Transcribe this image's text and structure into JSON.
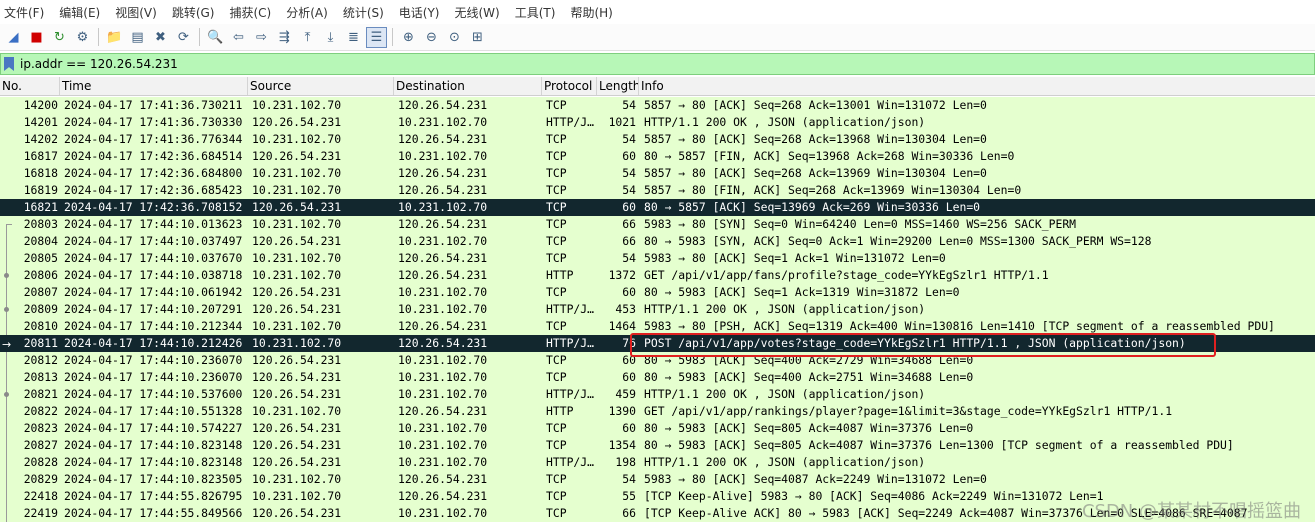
{
  "menu": [
    "文件(F)",
    "编辑(E)",
    "视图(V)",
    "跳转(G)",
    "捕获(C)",
    "分析(A)",
    "统计(S)",
    "电话(Y)",
    "无线(W)",
    "工具(T)",
    "帮助(H)"
  ],
  "toolbar": [
    {
      "name": "start-capture-icon",
      "glyph": "◢"
    },
    {
      "name": "stop-capture-icon",
      "glyph": "■"
    },
    {
      "name": "restart-capture-icon",
      "glyph": "↻"
    },
    {
      "name": "capture-options-icon",
      "glyph": "⚙"
    },
    {
      "sep": true
    },
    {
      "name": "open-file-icon",
      "glyph": "📁"
    },
    {
      "name": "save-file-icon",
      "glyph": "▤"
    },
    {
      "name": "close-file-icon",
      "glyph": "✖"
    },
    {
      "name": "reload-file-icon",
      "glyph": "⟳"
    },
    {
      "sep": true
    },
    {
      "name": "find-packet-icon",
      "glyph": "🔍"
    },
    {
      "name": "go-back-icon",
      "glyph": "⇦"
    },
    {
      "name": "go-forward-icon",
      "glyph": "⇨"
    },
    {
      "name": "go-to-packet-icon",
      "glyph": "⇶"
    },
    {
      "name": "go-first-packet-icon",
      "glyph": "⤒"
    },
    {
      "name": "go-last-packet-icon",
      "glyph": "⤓"
    },
    {
      "name": "auto-scroll-icon",
      "glyph": "≣"
    },
    {
      "name": "colorize-icon",
      "glyph": "☰",
      "active": true
    },
    {
      "sep": true
    },
    {
      "name": "zoom-in-icon",
      "glyph": "⊕"
    },
    {
      "name": "zoom-out-icon",
      "glyph": "⊖"
    },
    {
      "name": "zoom-normal-icon",
      "glyph": "⊙"
    },
    {
      "name": "resize-columns-icon",
      "glyph": "⊞"
    }
  ],
  "filter": {
    "value": "ip.addr == 120.26.54.231"
  },
  "columns": {
    "no": "No.",
    "time": "Time",
    "source": "Source",
    "destination": "Destination",
    "protocol": "Protocol",
    "length": "Length",
    "info": "Info"
  },
  "colors": {
    "row_bg": "#e5ffcf",
    "selected_bg": "#12272e",
    "filter_bg": "#b7f7b7",
    "highlight": "#e02020"
  },
  "packets": [
    {
      "no": "14200",
      "time": "2024-04-17 17:41:36.730211",
      "src": "10.231.102.70",
      "dst": "120.26.54.231",
      "proto": "TCP",
      "len": "54",
      "info": "5857 → 80 [ACK] Seq=268 Ack=13001 Win=131072 Len=0",
      "rel": "none",
      "sel": false
    },
    {
      "no": "14201",
      "time": "2024-04-17 17:41:36.730330",
      "src": "120.26.54.231",
      "dst": "10.231.102.70",
      "proto": "HTTP/J…",
      "len": "1021",
      "info": "HTTP/1.1 200 OK , JSON (application/json)",
      "rel": "none",
      "sel": false
    },
    {
      "no": "14202",
      "time": "2024-04-17 17:41:36.776344",
      "src": "10.231.102.70",
      "dst": "120.26.54.231",
      "proto": "TCP",
      "len": "54",
      "info": "5857 → 80 [ACK] Seq=268 Ack=13968 Win=130304 Len=0",
      "rel": "none",
      "sel": false
    },
    {
      "no": "16817",
      "time": "2024-04-17 17:42:36.684514",
      "src": "120.26.54.231",
      "dst": "10.231.102.70",
      "proto": "TCP",
      "len": "60",
      "info": "80 → 5857 [FIN, ACK] Seq=13968 Ack=268 Win=30336 Len=0",
      "rel": "none",
      "sel": false
    },
    {
      "no": "16818",
      "time": "2024-04-17 17:42:36.684800",
      "src": "10.231.102.70",
      "dst": "120.26.54.231",
      "proto": "TCP",
      "len": "54",
      "info": "5857 → 80 [ACK] Seq=268 Ack=13969 Win=130304 Len=0",
      "rel": "none",
      "sel": false
    },
    {
      "no": "16819",
      "time": "2024-04-17 17:42:36.685423",
      "src": "10.231.102.70",
      "dst": "120.26.54.231",
      "proto": "TCP",
      "len": "54",
      "info": "5857 → 80 [FIN, ACK] Seq=268 Ack=13969 Win=130304 Len=0",
      "rel": "none",
      "sel": false
    },
    {
      "no": "16821",
      "time": "2024-04-17 17:42:36.708152",
      "src": "120.26.54.231",
      "dst": "10.231.102.70",
      "proto": "TCP",
      "len": "60",
      "info": "80 → 5857 [ACK] Seq=13969 Ack=269 Win=30336 Len=0",
      "rel": "none",
      "sel": true
    },
    {
      "no": "20803",
      "time": "2024-04-17 17:44:10.013623",
      "src": "10.231.102.70",
      "dst": "120.26.54.231",
      "proto": "TCP",
      "len": "66",
      "info": "5983 → 80 [SYN] Seq=0 Win=64240 Len=0 MSS=1460 WS=256 SACK_PERM",
      "rel": "first",
      "sel": false
    },
    {
      "no": "20804",
      "time": "2024-04-17 17:44:10.037497",
      "src": "120.26.54.231",
      "dst": "10.231.102.70",
      "proto": "TCP",
      "len": "66",
      "info": "80 → 5983 [SYN, ACK] Seq=0 Ack=1 Win=29200 Len=0 MSS=1300 SACK_PERM WS=128",
      "rel": "line",
      "sel": false
    },
    {
      "no": "20805",
      "time": "2024-04-17 17:44:10.037670",
      "src": "10.231.102.70",
      "dst": "120.26.54.231",
      "proto": "TCP",
      "len": "54",
      "info": "5983 → 80 [ACK] Seq=1 Ack=1 Win=131072 Len=0",
      "rel": "line",
      "sel": false
    },
    {
      "no": "20806",
      "time": "2024-04-17 17:44:10.038718",
      "src": "10.231.102.70",
      "dst": "120.26.54.231",
      "proto": "HTTP",
      "len": "1372",
      "info": "GET /api/v1/app/fans/profile?stage_code=YYkEgSzlr1 HTTP/1.1",
      "rel": "dot",
      "sel": false
    },
    {
      "no": "20807",
      "time": "2024-04-17 17:44:10.061942",
      "src": "120.26.54.231",
      "dst": "10.231.102.70",
      "proto": "TCP",
      "len": "60",
      "info": "80 → 5983 [ACK] Seq=1 Ack=1319 Win=31872 Len=0",
      "rel": "line",
      "sel": false
    },
    {
      "no": "20809",
      "time": "2024-04-17 17:44:10.207291",
      "src": "120.26.54.231",
      "dst": "10.231.102.70",
      "proto": "HTTP/J…",
      "len": "453",
      "info": "HTTP/1.1 200 OK , JSON (application/json)",
      "rel": "dot",
      "sel": false
    },
    {
      "no": "20810",
      "time": "2024-04-17 17:44:10.212344",
      "src": "10.231.102.70",
      "dst": "120.26.54.231",
      "proto": "TCP",
      "len": "1464",
      "info": "5983 → 80 [PSH, ACK] Seq=1319 Ack=400 Win=130816 Len=1410 [TCP segment of a reassembled PDU]",
      "rel": "line",
      "sel": false
    },
    {
      "no": "20811",
      "time": "2024-04-17 17:44:10.212426",
      "src": "10.231.102.70",
      "dst": "120.26.54.231",
      "proto": "HTTP/J…",
      "len": "76",
      "info": "POST /api/v1/app/votes?stage_code=YYkEgSzlr1 HTTP/1.1 , JSON (application/json)",
      "rel": "arrow",
      "sel": true
    },
    {
      "no": "20812",
      "time": "2024-04-17 17:44:10.236070",
      "src": "120.26.54.231",
      "dst": "10.231.102.70",
      "proto": "TCP",
      "len": "60",
      "info": "80 → 5983 [ACK] Seq=400 Ack=2729 Win=34688 Len=0",
      "rel": "line",
      "sel": false
    },
    {
      "no": "20813",
      "time": "2024-04-17 17:44:10.236070",
      "src": "120.26.54.231",
      "dst": "10.231.102.70",
      "proto": "TCP",
      "len": "60",
      "info": "80 → 5983 [ACK] Seq=400 Ack=2751 Win=34688 Len=0",
      "rel": "line",
      "sel": false
    },
    {
      "no": "20821",
      "time": "2024-04-17 17:44:10.537600",
      "src": "120.26.54.231",
      "dst": "10.231.102.70",
      "proto": "HTTP/J…",
      "len": "459",
      "info": "HTTP/1.1 200 OK , JSON (application/json)",
      "rel": "dot",
      "sel": false
    },
    {
      "no": "20822",
      "time": "2024-04-17 17:44:10.551328",
      "src": "10.231.102.70",
      "dst": "120.26.54.231",
      "proto": "HTTP",
      "len": "1390",
      "info": "GET /api/v1/app/rankings/player?page=1&limit=3&stage_code=YYkEgSzlr1 HTTP/1.1",
      "rel": "line",
      "sel": false
    },
    {
      "no": "20823",
      "time": "2024-04-17 17:44:10.574227",
      "src": "120.26.54.231",
      "dst": "10.231.102.70",
      "proto": "TCP",
      "len": "60",
      "info": "80 → 5983 [ACK] Seq=805 Ack=4087 Win=37376 Len=0",
      "rel": "line",
      "sel": false
    },
    {
      "no": "20827",
      "time": "2024-04-17 17:44:10.823148",
      "src": "120.26.54.231",
      "dst": "10.231.102.70",
      "proto": "TCP",
      "len": "1354",
      "info": "80 → 5983 [ACK] Seq=805 Ack=4087 Win=37376 Len=1300 [TCP segment of a reassembled PDU]",
      "rel": "line",
      "sel": false
    },
    {
      "no": "20828",
      "time": "2024-04-17 17:44:10.823148",
      "src": "120.26.54.231",
      "dst": "10.231.102.70",
      "proto": "HTTP/J…",
      "len": "198",
      "info": "HTTP/1.1 200 OK , JSON (application/json)",
      "rel": "line",
      "sel": false
    },
    {
      "no": "20829",
      "time": "2024-04-17 17:44:10.823505",
      "src": "10.231.102.70",
      "dst": "120.26.54.231",
      "proto": "TCP",
      "len": "54",
      "info": "5983 → 80 [ACK] Seq=4087 Ack=2249 Win=131072 Len=0",
      "rel": "line",
      "sel": false
    },
    {
      "no": "22418",
      "time": "2024-04-17 17:44:55.826795",
      "src": "10.231.102.70",
      "dst": "120.26.54.231",
      "proto": "TCP",
      "len": "55",
      "info": "[TCP Keep-Alive] 5983 → 80 [ACK] Seq=4086 Ack=2249 Win=131072 Len=1",
      "rel": "line",
      "sel": false
    },
    {
      "no": "22419",
      "time": "2024-04-17 17:44:55.849566",
      "src": "120.26.54.231",
      "dst": "10.231.102.70",
      "proto": "TCP",
      "len": "66",
      "info": "[TCP Keep-Alive ACK] 80 → 5983 [ACK] Seq=2249 Ack=4087 Win=37376 Len=0 SLE=4086 SRE=4087",
      "rel": "line",
      "sel": false
    }
  ],
  "watermark": "CSDN @某某村不唱摇篮曲"
}
